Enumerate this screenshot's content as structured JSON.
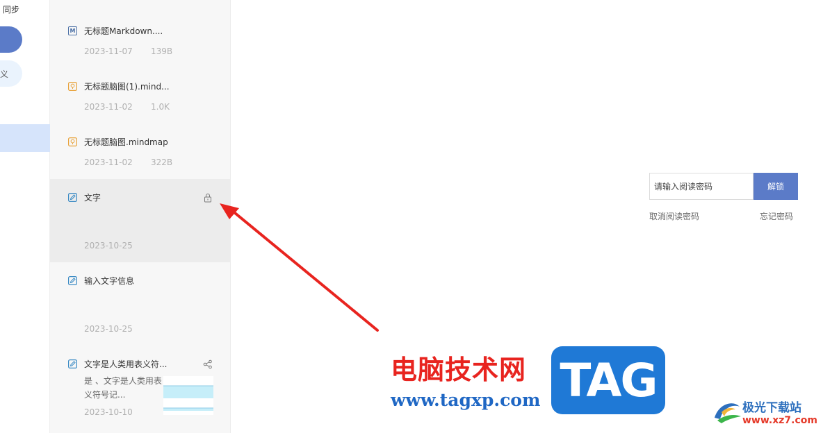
{
  "nav": {
    "sync_label": "同步",
    "secondary_glyph": "义"
  },
  "files": [
    {
      "name": "无标题Markdown....",
      "icon": "markdown-icon",
      "date": "2023-11-07",
      "size": "139B"
    },
    {
      "name": "无标题脑图(1).mind...",
      "icon": "mindmap-icon",
      "date": "2023-11-02",
      "size": "1.0K"
    },
    {
      "name": "无标题脑图.mindmap",
      "icon": "mindmap-icon",
      "date": "2023-11-02",
      "size": "322B"
    },
    {
      "name": "文字",
      "icon": "note-icon",
      "date": "2023-10-25",
      "size": "",
      "locked": true
    },
    {
      "name": "输入文字信息",
      "icon": "note-icon",
      "date": "2023-10-25",
      "size": ""
    },
    {
      "name": "文字是人类用表义符...",
      "icon": "note-icon",
      "date": "2023-10-10",
      "size": "",
      "shared": true,
      "preview": "是 、文字是人类用表义符号记..."
    }
  ],
  "lock_panel": {
    "password_placeholder": "请输入阅读密码",
    "unlock_label": "解锁",
    "cancel_label": "取消阅读密码",
    "forgot_label": "忘记密码"
  },
  "watermark": {
    "cn_text": "电脑技术网",
    "url_text": "www.tagxp.com",
    "tag_text": "TAG",
    "site_name": "极光下载站",
    "site_url": "www.xz7.com"
  },
  "colors": {
    "accent": "#5b7bc8",
    "selected_item": "#ececec",
    "arrow": "#e8241f",
    "markdown_icon": "#4a6fa5",
    "mindmap_icon": "#e8a23a",
    "note_icon": "#3a8ac4"
  }
}
